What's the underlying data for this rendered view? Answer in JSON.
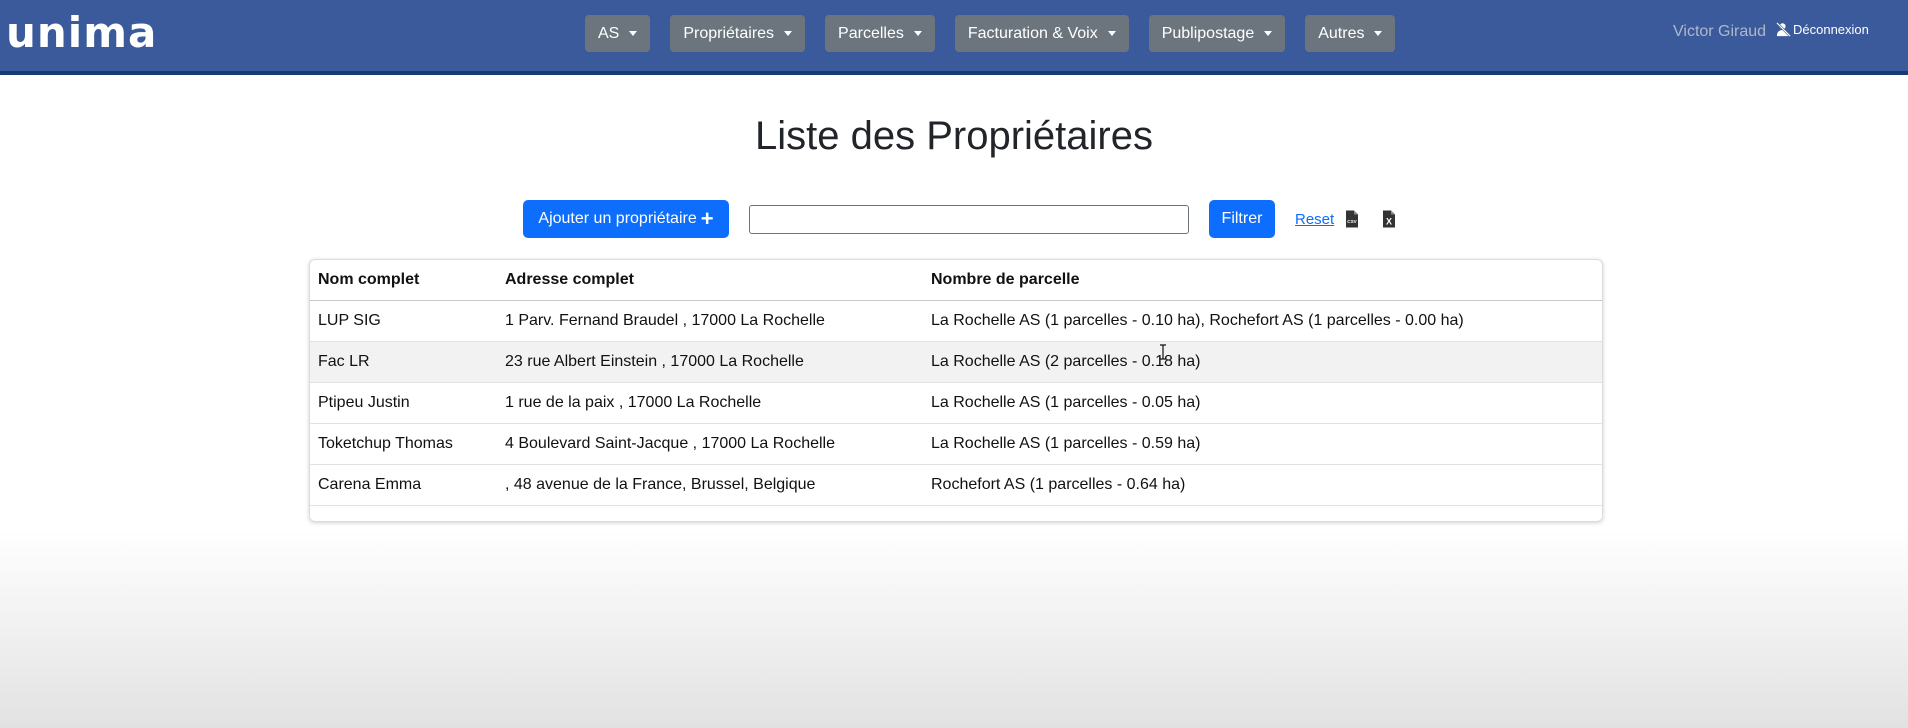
{
  "brand": {
    "logo_text": "unima"
  },
  "nav": {
    "items": [
      {
        "label": "AS"
      },
      {
        "label": "Propriétaires"
      },
      {
        "label": "Parcelles"
      },
      {
        "label": "Facturation & Voix"
      },
      {
        "label": "Publipostage"
      },
      {
        "label": "Autres"
      }
    ]
  },
  "user": {
    "name": "Victor Giraud",
    "logout_label": "Déconnexion"
  },
  "page": {
    "title": "Liste des Propriétaires"
  },
  "toolbar": {
    "add_label": "Ajouter un propriétaire",
    "search_value": "",
    "filter_label": "Filtrer",
    "reset_label": "Reset",
    "csv_icon_text": "CSV",
    "excel_icon_text": "X"
  },
  "table": {
    "headers": [
      "Nom complet",
      "Adresse complet",
      "Nombre de parcelle"
    ],
    "rows": [
      [
        "LUP SIG",
        "1 Parv. Fernand Braudel , 17000 La Rochelle",
        "La Rochelle AS (1 parcelles - 0.10 ha), Rochefort AS (1 parcelles - 0.00 ha)"
      ],
      [
        "Fac LR",
        "23 rue Albert Einstein , 17000 La Rochelle",
        "La Rochelle AS (2 parcelles - 0.18 ha)"
      ],
      [
        "Ptipeu Justin",
        "1 rue de la paix , 17000 La Rochelle",
        "La Rochelle AS (1 parcelles - 0.05 ha)"
      ],
      [
        "Toketchup Thomas",
        "4 Boulevard Saint-Jacque , 17000 La Rochelle",
        "La Rochelle AS (1 parcelles - 0.59 ha)"
      ],
      [
        "Carena Emma",
        ", 48 avenue de la France, Brussel, Belgique",
        "Rochefort AS (1 parcelles - 0.64 ha)"
      ]
    ]
  },
  "colors": {
    "navbar": "#3a5a9b",
    "nav_button": "#6c757d",
    "primary": "#0d6efd",
    "row_stripe": "#f2f2f2"
  }
}
